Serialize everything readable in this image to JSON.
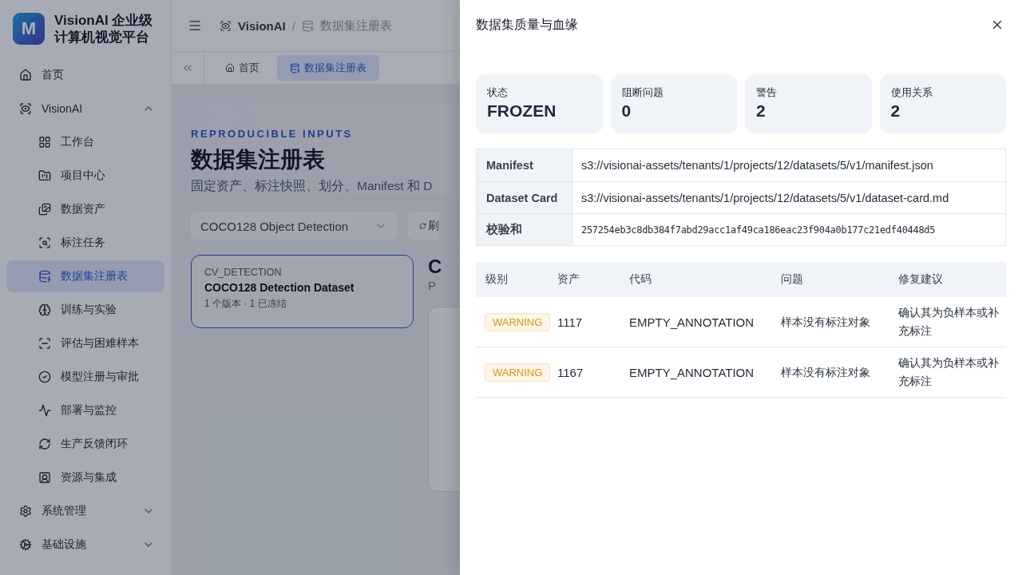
{
  "sidebar": {
    "brand": {
      "logo": "M",
      "title": "VisionAI 企业级计算机视觉平台"
    },
    "items": [
      {
        "kind": "link",
        "label": "首页",
        "selected": false
      },
      {
        "kind": "group",
        "label": "VisionAI",
        "selected": false,
        "expanded": true,
        "children": [
          {
            "label": "工作台",
            "selected": false
          },
          {
            "label": "项目中心",
            "selected": false
          },
          {
            "label": "数据资产",
            "selected": false
          },
          {
            "label": "标注任务",
            "selected": false
          },
          {
            "label": "数据集注册表",
            "selected": true
          },
          {
            "label": "训练与实验",
            "selected": false
          },
          {
            "label": "评估与困难样本",
            "selected": false
          },
          {
            "label": "模型注册与审批",
            "selected": false
          },
          {
            "label": "部署与监控",
            "selected": false
          },
          {
            "label": "生产反馈闭环",
            "selected": false
          },
          {
            "label": "资源与集成",
            "selected": false
          }
        ]
      },
      {
        "kind": "group",
        "label": "系统管理",
        "selected": false,
        "expanded": false
      },
      {
        "kind": "group",
        "label": "基础设施",
        "selected": false,
        "expanded": false
      }
    ]
  },
  "header": {
    "breadcrumb": [
      {
        "label": "VisionAI"
      },
      {
        "label": "数据集注册表"
      }
    ],
    "separator": "/"
  },
  "tabs": [
    {
      "label": "首页",
      "selected": false
    },
    {
      "label": "数据集注册表",
      "selected": true
    }
  ],
  "page": {
    "eyebrow": "REPRODUCIBLE INPUTS",
    "title": "数据集注册表",
    "subtitle": "固定资产、标注快照、划分、Manifest 和 D",
    "select": {
      "value": "COCO128 Object Detection"
    },
    "refresh_button": "刷",
    "datasets": [
      {
        "category": "CV_DETECTION",
        "name": "COCO128 Detection Dataset",
        "meta": "1 个版本 · 1 已冻结",
        "selected": true
      }
    ],
    "detail": {
      "title": "C",
      "subtitle": "P"
    }
  },
  "drawer": {
    "title": "数据集质量与血缘",
    "stats": [
      {
        "label": "状态",
        "value": "FROZEN"
      },
      {
        "label": "阻断问题",
        "value": "0"
      },
      {
        "label": "警告",
        "value": "2"
      },
      {
        "label": "使用关系",
        "value": "2"
      }
    ],
    "files": [
      {
        "kind": "path",
        "key": "Manifest",
        "value": "s3://visionai-assets/tenants/1/projects/12/datasets/5/v1/manifest.json"
      },
      {
        "kind": "path",
        "key": "Dataset Card",
        "value": "s3://visionai-assets/tenants/1/projects/12/datasets/5/v1/dataset-card.md"
      },
      {
        "kind": "hash",
        "key": "校验和",
        "value": "257254eb3c8db384f7abd29acc1af49ca186eac23f904a0b177c21edf40448d5"
      }
    ],
    "issues": {
      "columns": [
        "级别",
        "资产",
        "代码",
        "问题",
        "修复建议"
      ],
      "rows": [
        {
          "level": "WARNING",
          "asset": "1117",
          "code": "EMPTY_ANNOTATION",
          "problem": "样本没有标注对象",
          "fix": "确认其为负样本或补充标注"
        },
        {
          "level": "WARNING",
          "asset": "1167",
          "code": "EMPTY_ANNOTATION",
          "problem": "样本没有标注对象",
          "fix": "确认其为负样本或补充标注"
        }
      ]
    }
  }
}
